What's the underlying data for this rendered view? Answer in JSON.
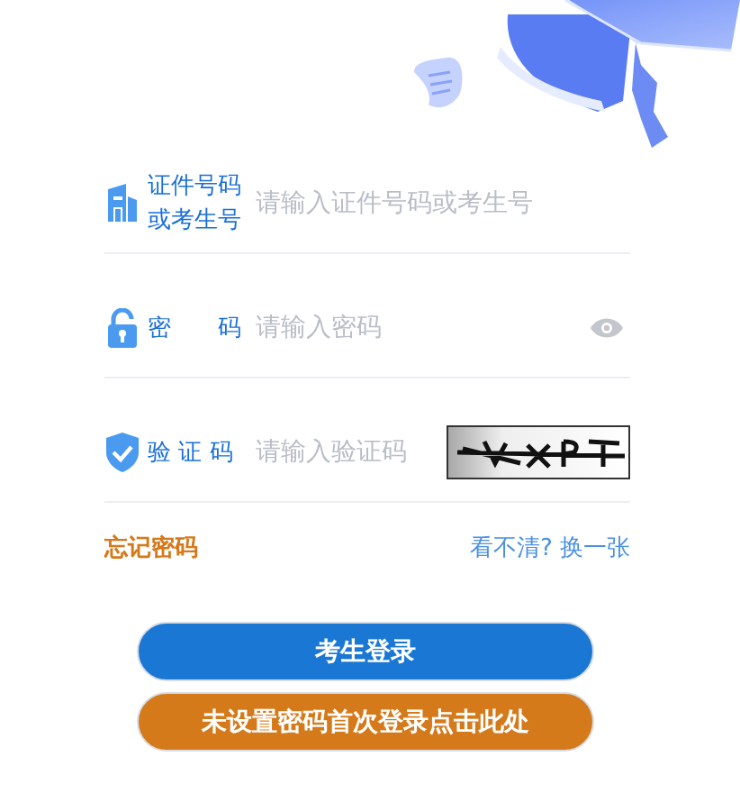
{
  "fields": [
    {
      "kind": "id",
      "label": "证件号码或考生号",
      "placeholder": "请输入证件号码或考生号"
    },
    {
      "kind": "password",
      "label": "密　　码",
      "placeholder": "请输入密码"
    },
    {
      "kind": "captcha",
      "label": "验 证 码",
      "placeholder": "请输入验证码"
    }
  ],
  "links": {
    "forgot": "忘记密码",
    "refresh": "看不清? 换一张"
  },
  "buttons": [
    {
      "kind": "primary",
      "label": "考生登录"
    },
    {
      "kind": "secondary",
      "label": "未设置密码首次登录点击此处"
    }
  ]
}
